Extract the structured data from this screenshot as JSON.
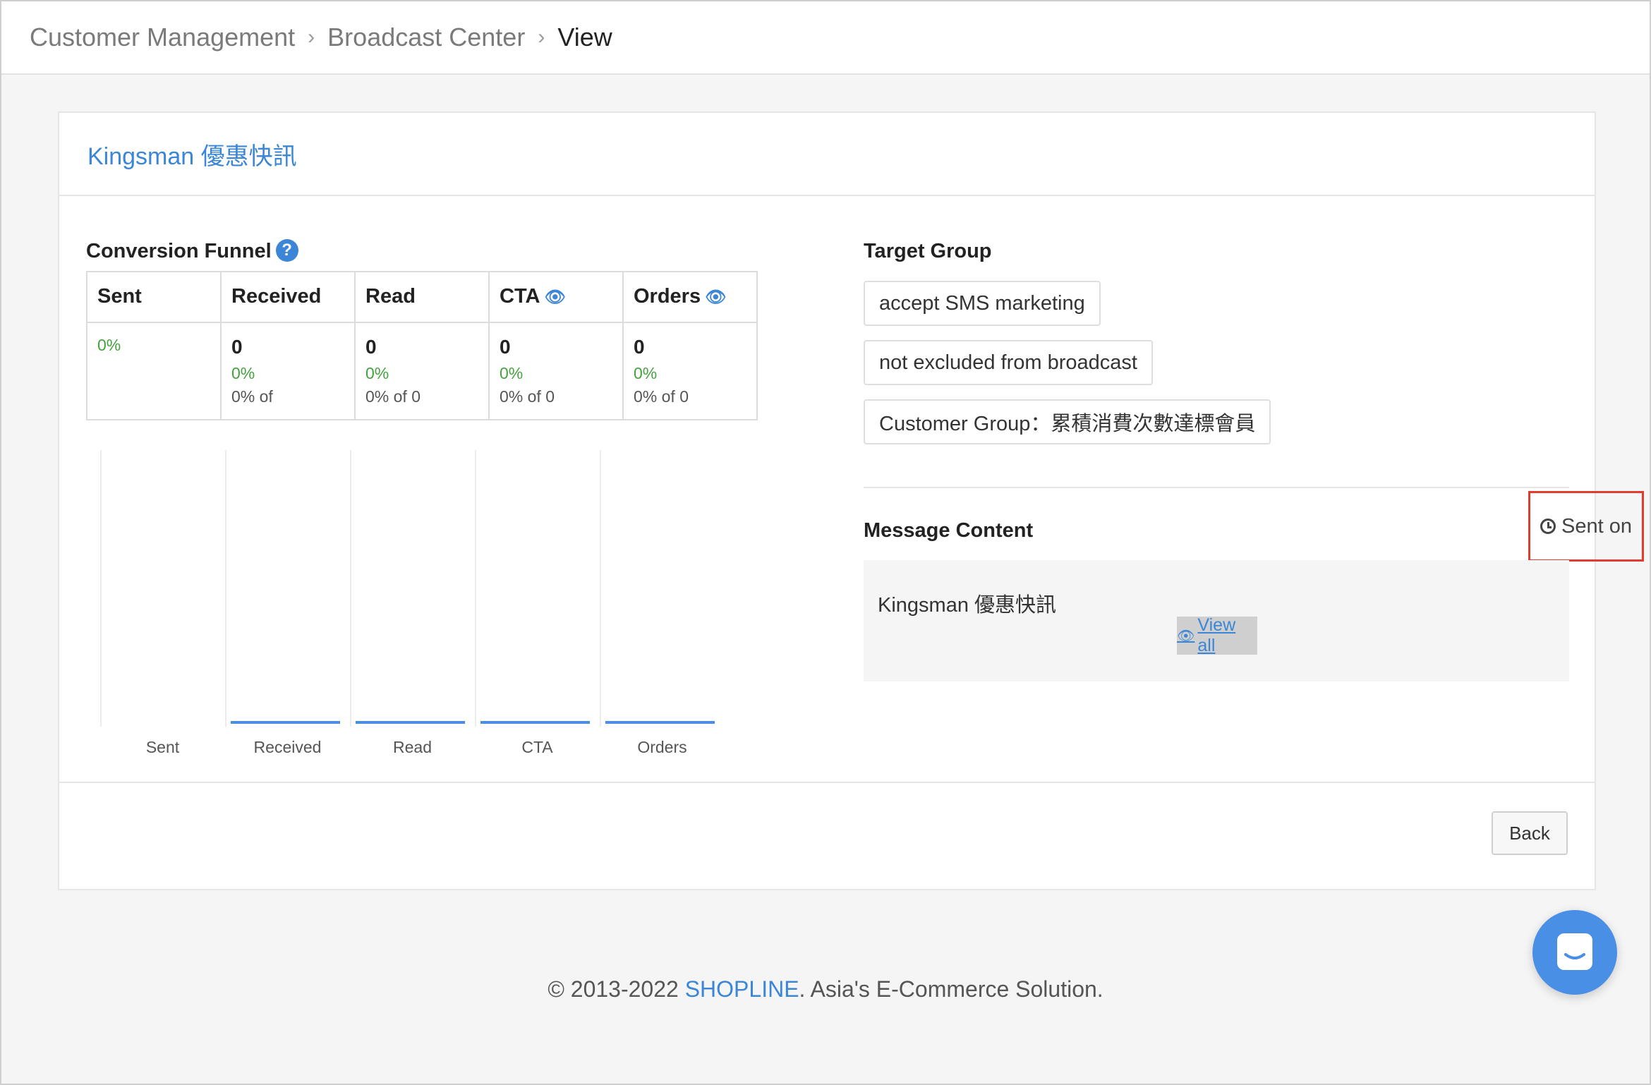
{
  "breadcrumb": {
    "items": [
      "Customer Management",
      "Broadcast Center",
      "View"
    ]
  },
  "panel": {
    "title": "Kingsman 優惠快訊"
  },
  "funnel": {
    "label": "Conversion Funnel",
    "help_glyph": "?",
    "columns": [
      "Sent",
      "Received",
      "Read",
      "CTA",
      "Orders"
    ],
    "eye_glyph": "👁",
    "cells": [
      {
        "count": "",
        "pct": "0%",
        "of": ""
      },
      {
        "count": "0",
        "pct": "0%",
        "of": "0% of"
      },
      {
        "count": "0",
        "pct": "0%",
        "of": "0% of 0"
      },
      {
        "count": "0",
        "pct": "0%",
        "of": "0% of 0"
      },
      {
        "count": "0",
        "pct": "0%",
        "of": "0% of 0"
      }
    ]
  },
  "chart_data": {
    "type": "bar",
    "categories": [
      "Sent",
      "Received",
      "Read",
      "CTA",
      "Orders"
    ],
    "values": [
      0,
      0,
      0,
      0,
      0
    ],
    "title": "",
    "xlabel": "",
    "ylabel": "",
    "bar_color": "#4a8fe0"
  },
  "target_group": {
    "label": "Target Group",
    "tags": [
      "accept SMS marketing",
      "not excluded from broadcast",
      "Customer Group：累積消費次數達標會員"
    ]
  },
  "message": {
    "label": "Message Content",
    "sent_on": "Sent on",
    "text": "Kingsman 優惠快訊",
    "view_all": "View all"
  },
  "actions": {
    "back_label": "Back"
  },
  "footer": {
    "prefix": "© 2013-2022 ",
    "brand": "SHOPLINE",
    "suffix": ". Asia's E-Commerce Solution."
  },
  "colors": {
    "accent": "#3b86d6",
    "success": "#44a33c",
    "highlight": "#e03c2f"
  }
}
